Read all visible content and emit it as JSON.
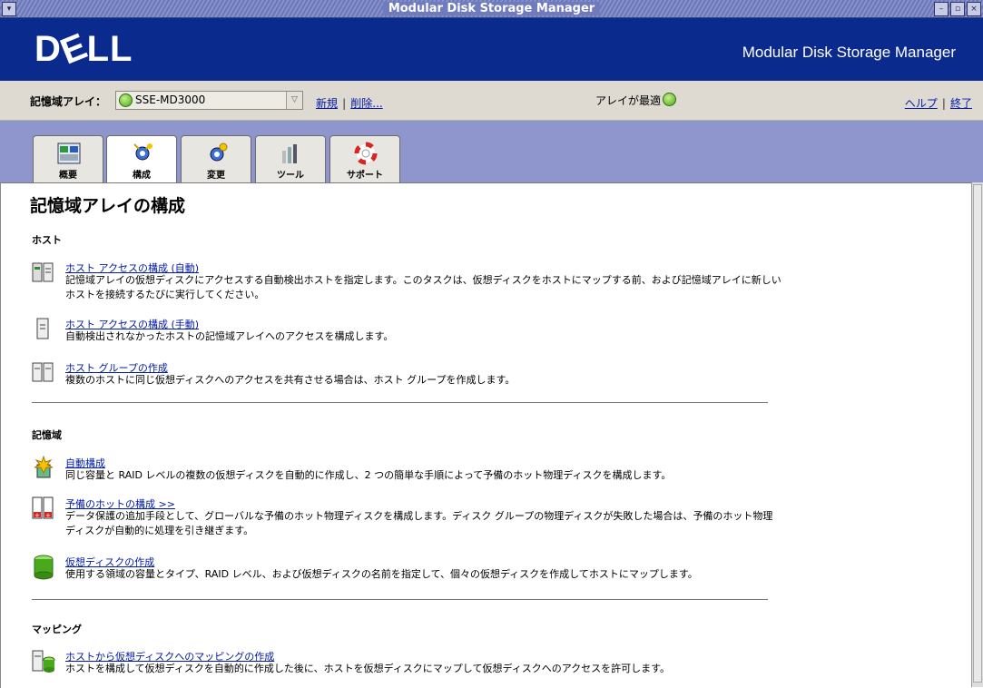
{
  "window": {
    "title": "Modular Disk Storage Manager"
  },
  "header": {
    "logo": "DELL",
    "app_name": "Modular Disk Storage Manager"
  },
  "array_bar": {
    "label": "記憶域アレイ：",
    "selected_array": "SSE-MD3000",
    "new_link": "新規",
    "separator": "|",
    "delete_link": "削除...",
    "status_text": "アレイが最適",
    "help_link": "ヘルプ",
    "exit_link": "終了"
  },
  "tabs": [
    {
      "label": "概要",
      "icon": "summary-icon"
    },
    {
      "label": "構成",
      "icon": "configure-icon"
    },
    {
      "label": "変更",
      "icon": "modify-icon"
    },
    {
      "label": "ツール",
      "icon": "tools-icon"
    },
    {
      "label": "サポート",
      "icon": "support-icon"
    }
  ],
  "active_tab": "構成",
  "content": {
    "page_title": "記憶域アレイの構成",
    "sections": [
      {
        "heading": "ホスト",
        "items": [
          {
            "link": "ホスト アクセスの構成 (自動)",
            "desc": "記憶域アレイの仮想ディスクにアクセスする自動検出ホストを指定します。このタスクは、仮想ディスクをホストにマップする前、および記憶域アレイに新しいホストを接続するたびに実行してください。"
          },
          {
            "link": "ホスト アクセスの構成 (手動)",
            "desc": "自動検出されなかったホストの記憶域アレイへのアクセスを構成します。"
          },
          {
            "link": "ホスト グループの作成",
            "desc": "複数のホストに同じ仮想ディスクへのアクセスを共有させる場合は、ホスト グループを作成します。"
          }
        ]
      },
      {
        "heading": "記憶域",
        "items": [
          {
            "link": "自動構成",
            "desc": "同じ容量と RAID レベルの複数の仮想ディスクを自動的に作成し、2 つの簡単な手順によって予備のホット物理ディスクを構成します。"
          },
          {
            "link": "予備のホットの構成 >>",
            "desc": "データ保護の追加手段として、グローバルな予備のホット物理ディスクを構成します。ディスク グループの物理ディスクが失敗した場合は、予備のホット物理ディスクが自動的に処理を引き継ぎます。"
          },
          {
            "link": "仮想ディスクの作成",
            "desc": "使用する領域の容量とタイプ、RAID レベル、および仮想ディスクの名前を指定して、個々の仮想ディスクを作成してホストにマップします。"
          }
        ]
      },
      {
        "heading": "マッピング",
        "items": [
          {
            "link": "ホストから仮想ディスクへのマッピングの作成",
            "desc": "ホストを構成して仮想ディスクを自動的に作成した後に、ホストを仮想ディスクにマップして仮想ディスクへのアクセスを許可します。"
          }
        ]
      }
    ]
  },
  "colors": {
    "header_bg": "#0b2a8e",
    "tabstrip_bg": "#8f96ce",
    "link": "#0019a8",
    "status_ok": "#4aa81c"
  }
}
